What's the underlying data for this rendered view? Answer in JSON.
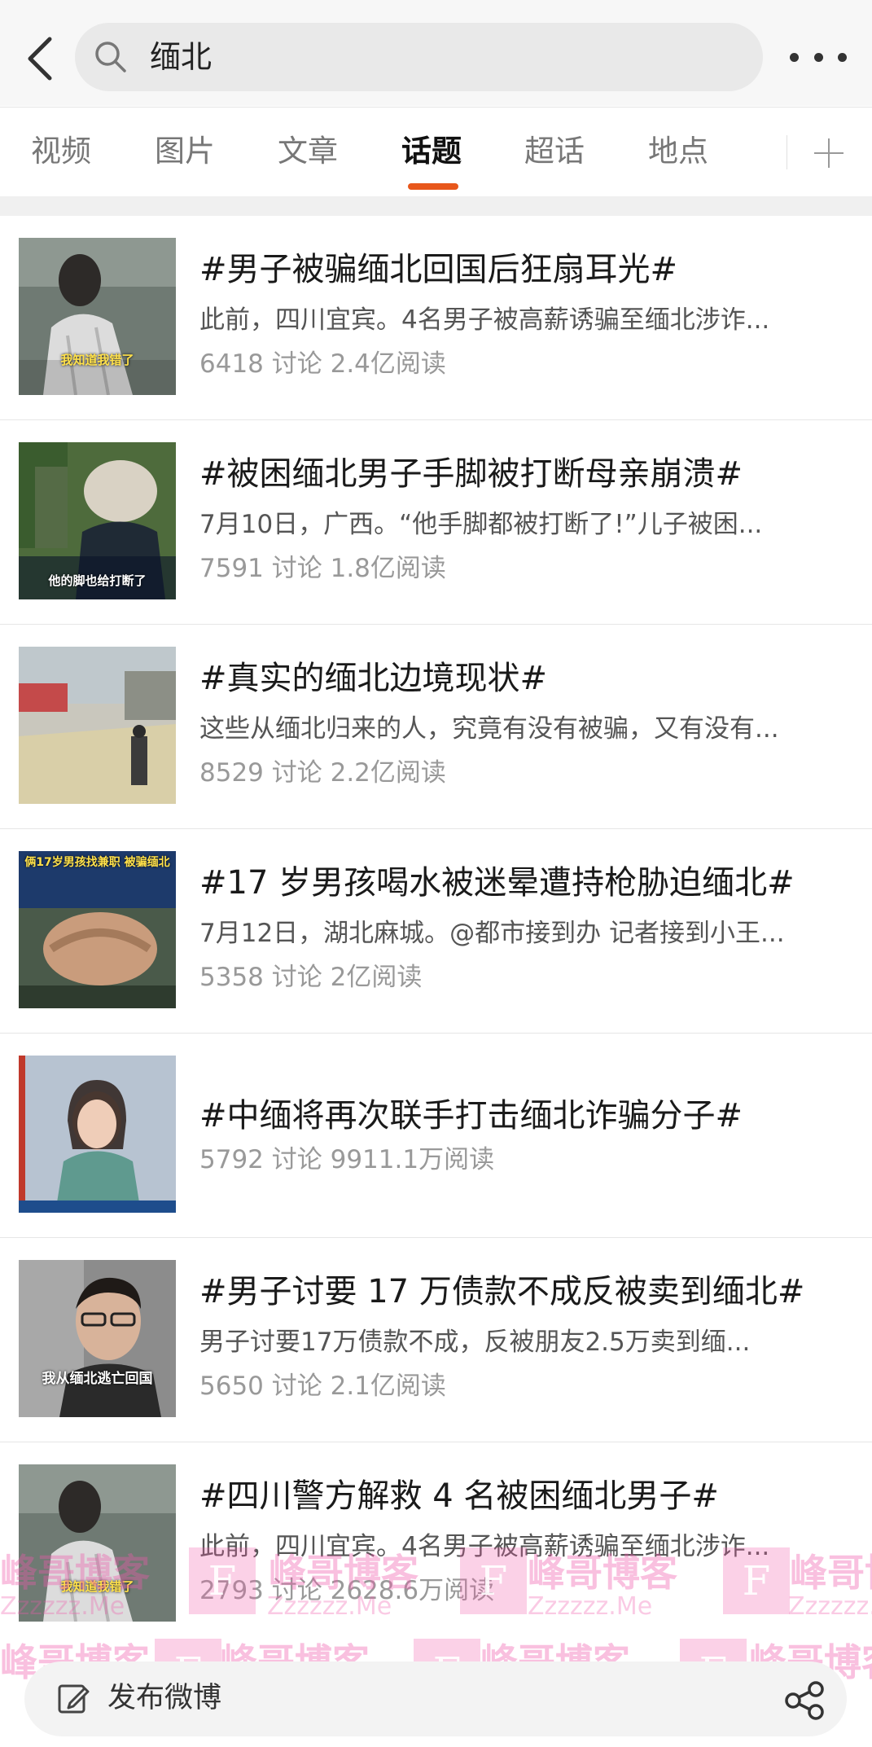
{
  "header": {
    "back_icon": "chevron-left-icon",
    "search_query": "缅北",
    "more_icon": "more-dots-icon"
  },
  "tabs": [
    {
      "label": "视频",
      "active": false
    },
    {
      "label": "图片",
      "active": false
    },
    {
      "label": "文章",
      "active": false
    },
    {
      "label": "话题",
      "active": true
    },
    {
      "label": "超话",
      "active": false
    },
    {
      "label": "地点",
      "active": false
    }
  ],
  "accent_color": "#e8571b",
  "topics": [
    {
      "title": "#男子被骗缅北回国后狂扇耳光#",
      "desc": "此前，四川宜宾。4名男子被高薪诱骗至缅北涉诈...",
      "stats": "6418 讨论 2.4亿阅读",
      "thumb_caption": "我知道我错了"
    },
    {
      "title": "#被困缅北男子手脚被打断母亲崩溃#",
      "desc": "7月10日，广西。“他手脚都被打断了!”儿子被困...",
      "stats": "7591 讨论 1.8亿阅读",
      "thumb_caption": "他的脚也给打断了"
    },
    {
      "title": "#真实的缅北边境现状#",
      "desc": "这些从缅北归来的人，究竟有没有被骗，又有没有...",
      "stats": "8529 讨论 2.2亿阅读",
      "thumb_caption": ""
    },
    {
      "title": "#17 岁男孩喝水被迷晕遭持枪胁迫缅北#",
      "desc": "7月12日，湖北麻城。@都市接到办 记者接到小王...",
      "stats": "5358 讨论 2亿阅读",
      "thumb_caption": "俩17岁男孩找兼职 被骗缅北"
    },
    {
      "title": "#中缅将再次联手打击缅北诈骗分子#",
      "desc": "",
      "stats": "5792 讨论 9911.1万阅读",
      "thumb_caption": ""
    },
    {
      "title": "#男子讨要 17 万债款不成反被卖到缅北#",
      "desc": "男子讨要17万债款不成，反被朋友2.5万卖到缅...",
      "stats": "5650 讨论 2.1亿阅读",
      "thumb_caption": "我从缅北逃亡回国"
    },
    {
      "title": "#四川警方解救 4 名被困缅北男子#",
      "desc": "此前，四川宜宾。4名男子被高薪诱骗至缅北涉诈...",
      "stats": "2793 讨论 2628.6万阅读",
      "thumb_caption": "我知道我错了"
    }
  ],
  "bottom_bar": {
    "compose_label": "发布微博",
    "compose_icon": "pencil-icon",
    "share_icon": "share-icon"
  },
  "watermark": {
    "text": "峰哥博客",
    "sub": "Zzzzzz.Me",
    "letter": "F"
  }
}
